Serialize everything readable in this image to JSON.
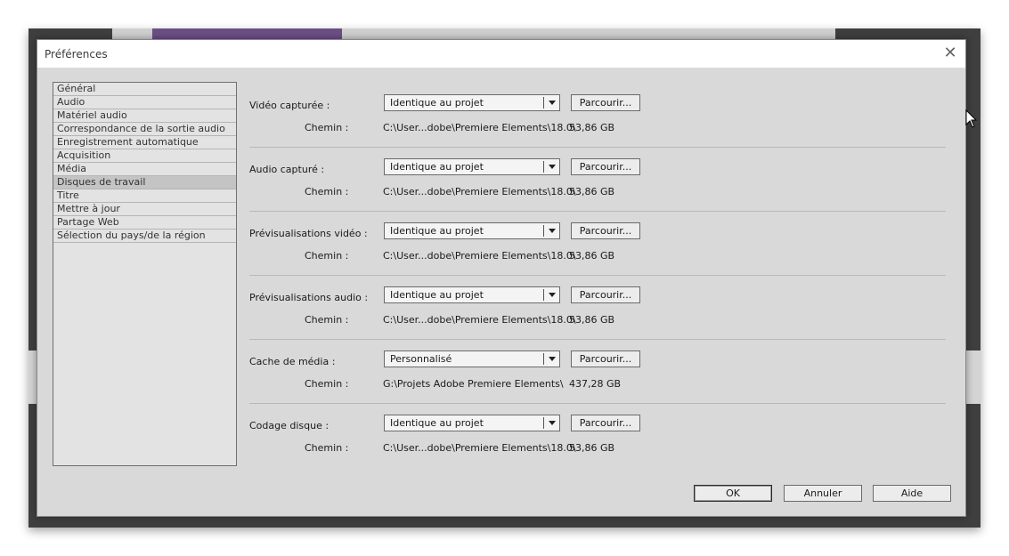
{
  "dialog": {
    "title": "Préférences",
    "close_glyph": "✕"
  },
  "categories": [
    {
      "label": "Général"
    },
    {
      "label": "Audio"
    },
    {
      "label": "Matériel audio"
    },
    {
      "label": "Correspondance de la sortie audio"
    },
    {
      "label": "Enregistrement automatique"
    },
    {
      "label": "Acquisition"
    },
    {
      "label": "Média"
    },
    {
      "label": "Disques de travail"
    },
    {
      "label": "Titre"
    },
    {
      "label": "Mettre à jour"
    },
    {
      "label": "Partage Web"
    },
    {
      "label": "Sélection du pays/de la région"
    }
  ],
  "selected_category": "Disques de travail",
  "path_label": "Chemin :",
  "browse_label": "Parcourir...",
  "sections": [
    {
      "label": "Vidéo capturée :",
      "value": "Identique au projet",
      "path": "C:\\User...dobe\\Premiere Elements\\18.0\\",
      "size": "53,86 GB"
    },
    {
      "label": "Audio capturé :",
      "value": "Identique au projet",
      "path": "C:\\User...dobe\\Premiere Elements\\18.0\\",
      "size": "53,86 GB"
    },
    {
      "label": "Prévisualisations vidéo :",
      "value": "Identique au projet",
      "path": "C:\\User...dobe\\Premiere Elements\\18.0\\",
      "size": "53,86 GB"
    },
    {
      "label": "Prévisualisations audio :",
      "value": "Identique au projet",
      "path": "C:\\User...dobe\\Premiere Elements\\18.0\\",
      "size": "53,86 GB"
    },
    {
      "label": "Cache de média :",
      "value": "Personnalisé",
      "path": "G:\\Projets Adobe Premiere Elements\\",
      "size": "437,28 GB"
    },
    {
      "label": "Codage disque :",
      "value": "Identique au projet",
      "path": "C:\\User...dobe\\Premiere Elements\\18.0\\",
      "size": "53,86 GB"
    }
  ],
  "buttons": {
    "ok": "OK",
    "cancel": "Annuler",
    "help": "Aide"
  },
  "colors": {
    "dialog_bg": "#d9d9d9",
    "app_bg": "#3f3f3f",
    "accent_purple": "#6a4f86"
  }
}
